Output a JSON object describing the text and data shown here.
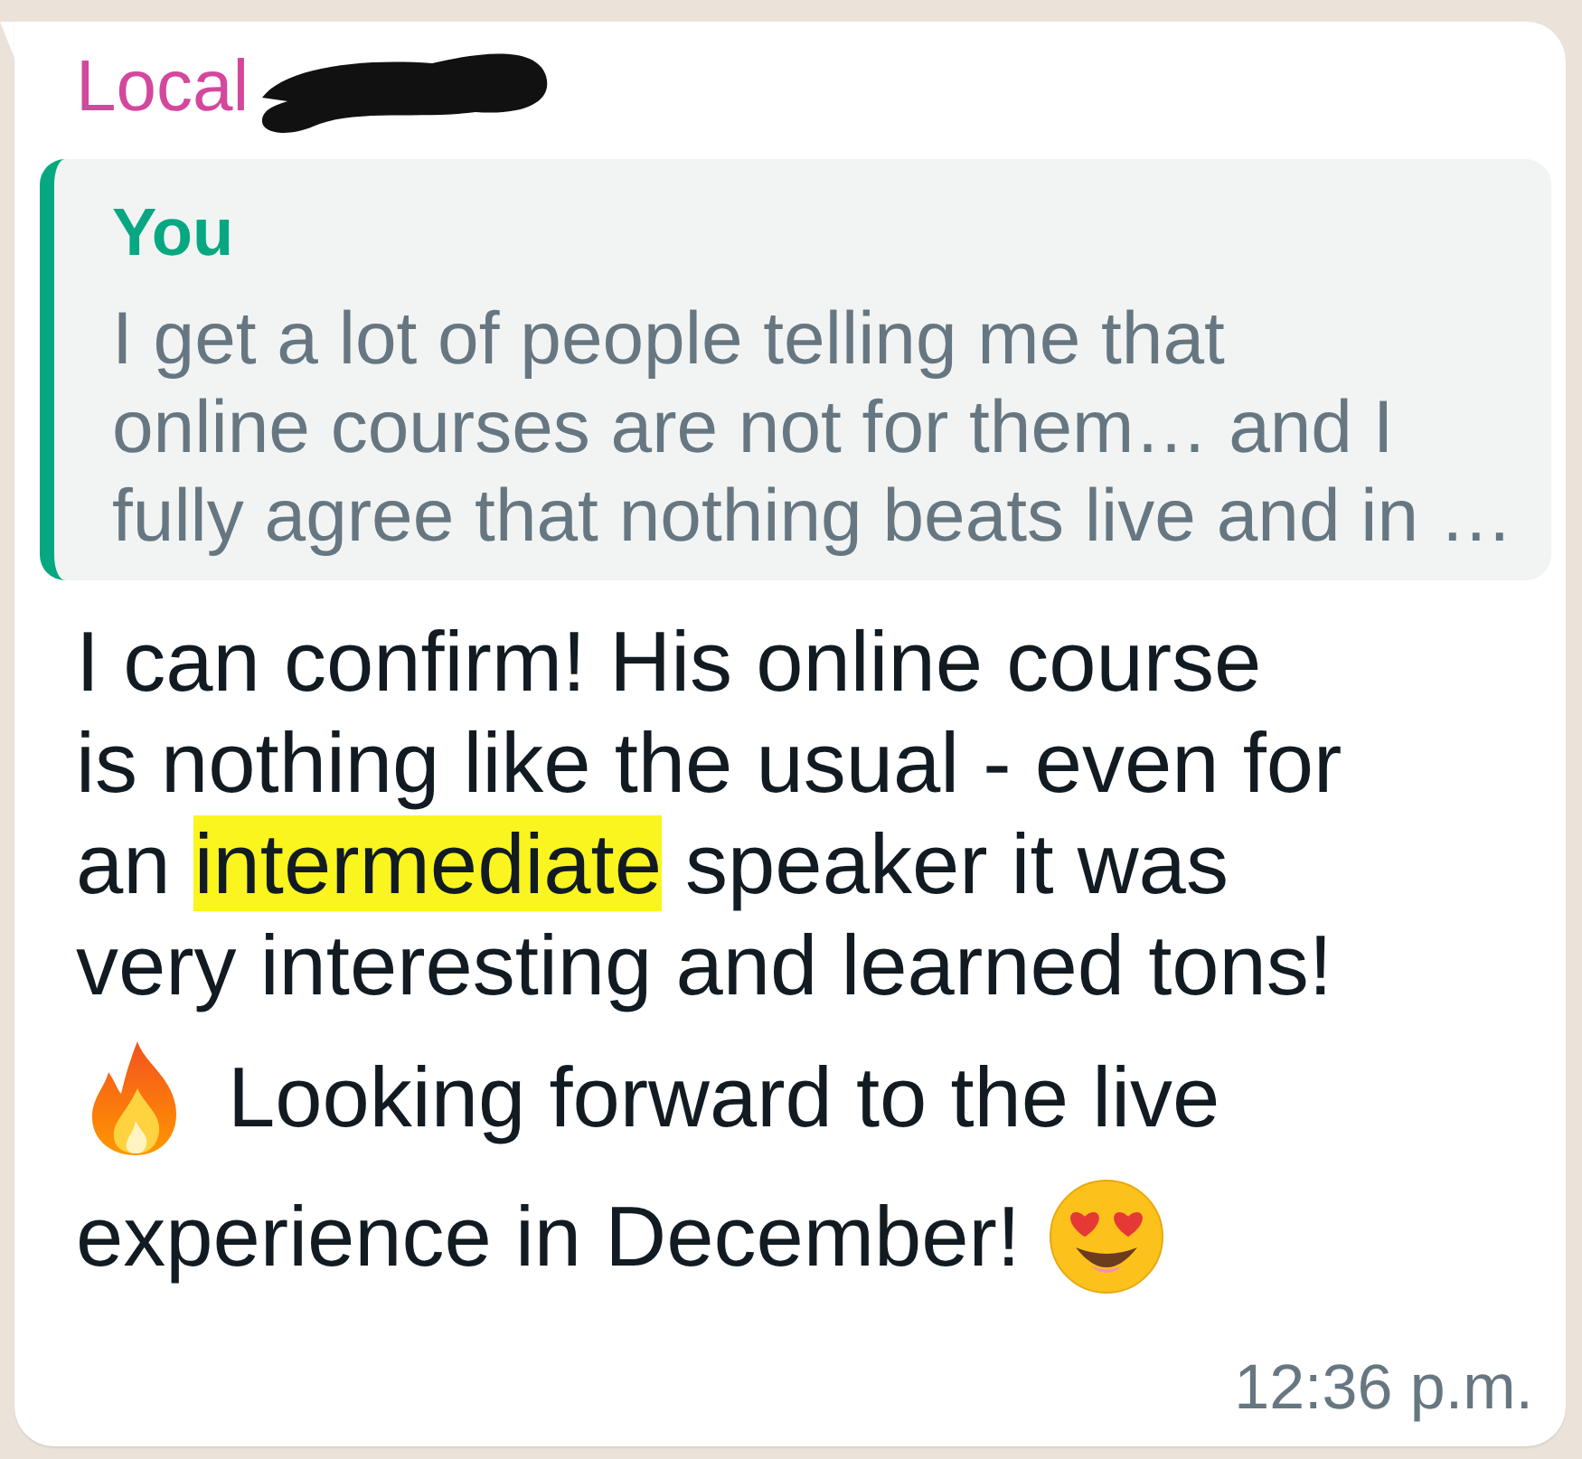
{
  "sender": {
    "name": "Local",
    "redacted": true
  },
  "quote": {
    "author": "You",
    "lines": [
      "I get a lot of people telling me that",
      "online courses are not for them… and I",
      "fully agree that nothing beats live and in …"
    ]
  },
  "message": {
    "lines": [
      [
        {
          "kind": "text",
          "text": "I can confirm! His online course"
        }
      ],
      [
        {
          "kind": "text",
          "text": "is nothing like the usual - even for"
        }
      ],
      [
        {
          "kind": "text",
          "text": "an "
        },
        {
          "kind": "highlight",
          "text": "intermediate"
        },
        {
          "kind": "text",
          "text": " speaker it was"
        }
      ],
      [
        {
          "kind": "text",
          "text": "very interesting and learned tons!"
        }
      ],
      [
        {
          "kind": "fire"
        },
        {
          "kind": "text",
          "text": "Looking forward to the live"
        }
      ],
      [
        {
          "kind": "text",
          "text": "experience in December!"
        },
        {
          "kind": "hearteyes"
        }
      ]
    ]
  },
  "time": "12:36 p.m."
}
